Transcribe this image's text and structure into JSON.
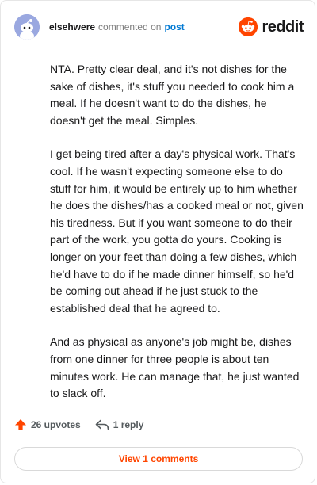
{
  "header": {
    "username": "elsehwere",
    "action_text": "commented on",
    "post_link": "post",
    "brand_name": "reddit"
  },
  "comment": {
    "paragraphs": [
      "NTA. Pretty clear deal, and it's not dishes for the sake of dishes, it's stuff you needed to cook him a meal. If he doesn't want to do the dishes, he doesn't get the meal. Simples.",
      "I get being tired after a day's physical work. That's cool. If he wasn't expecting someone else to do stuff for him, it would be entirely up to him whether he does the dishes/has a cooked meal or not, given his tiredness. But if you want someone to do their part of the work, you gotta do yours. Cooking is longer on your feet than doing a few dishes, which he'd have to do if he made dinner himself, so he'd be coming out ahead if he just stuck to the established deal that he agreed to.",
      "And as physical as anyone's job might be, dishes from one dinner for three people is about ten minutes work. He can manage that, he just wanted to slack off."
    ]
  },
  "footer": {
    "upvotes_label": "26 upvotes",
    "reply_label": "1 reply",
    "view_comments_label": "View 1 comments"
  },
  "colors": {
    "brand_orange": "#ff4500",
    "link_blue": "#0079d3",
    "avatar_bg": "#9aa8e0"
  },
  "icons": {
    "avatar": "snoo-avatar-icon",
    "brand": "reddit-logo-icon",
    "upvote": "upvote-arrow-icon",
    "reply": "reply-arrow-icon"
  }
}
